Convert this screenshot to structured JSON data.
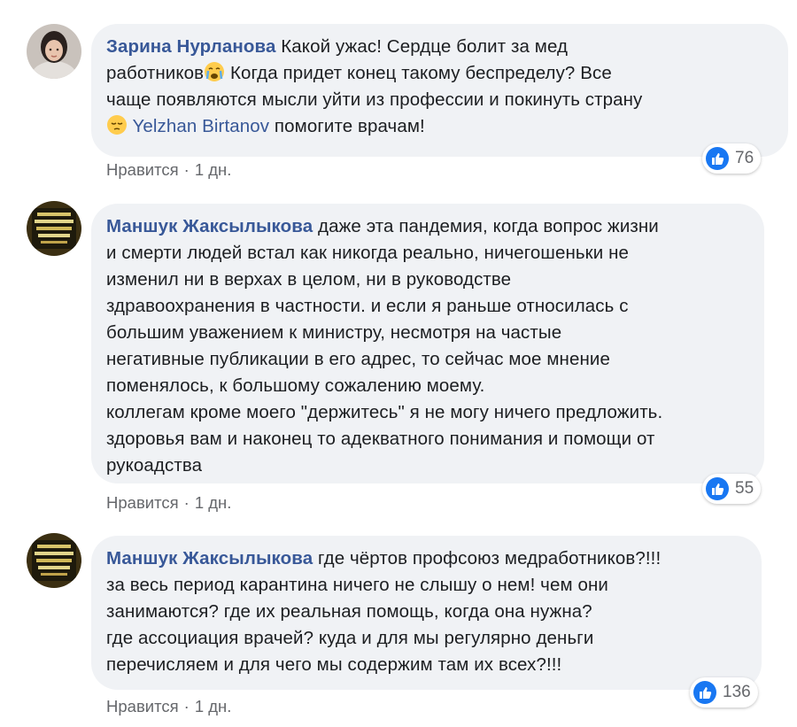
{
  "comments": [
    {
      "author": "Зарина Нурланова",
      "lines": [
        "Какой ужас! Сердце болит за мед",
        "работников",
        " Когда придет конец такому беспределу? Все",
        "чаще появляются мысли уйти из профессии и покинуть страну",
        "Yelzhan Birtanov",
        " помогите врачам!"
      ],
      "emoji_1": "crying-face-emoji",
      "emoji_2": "pensive-face-emoji",
      "reaction_count": "76",
      "like_label": "Нравится",
      "separator": "·",
      "time": "1 дн."
    },
    {
      "author": "Маншук Жаксылыкова",
      "lines": [
        "даже эта пандемия, когда вопрос жизни",
        "и смерти людей встал как никогда реально, ничегошеньки не",
        "изменил ни в верхах в целом, ни в руководстве",
        "здравоохранения в частности. и если я раньше относилась с",
        "большим уважением к министру, несмотря на частые",
        "негативные публикации в его адрес, то сейчас мое мнение",
        "поменялось, к большому сожалению моему.",
        "коллегам кроме моего \"держитесь\" я не могу ничего предложить.",
        "здоровья вам и наконец то адекватного понимания и помощи от",
        "рукоадства"
      ],
      "reaction_count": "55",
      "like_label": "Нравится",
      "separator": "·",
      "time": "1 дн."
    },
    {
      "author": "Маншук Жаксылыкова",
      "lines": [
        "где чёртов профсоюз медработников?!!!",
        "за весь период карантина ничего не слышу о нем! чем они",
        "занимаются? где их реальная помощь, когда она нужна?",
        "где ассоциация врачей? куда и для мы регулярно деньги",
        "перечисляем и для чего мы содержим там их всех?!!!"
      ],
      "reaction_count": "136",
      "like_label": "Нравится",
      "separator": "·",
      "time": "1 дн."
    }
  ],
  "colors": {
    "bubble": "#f0f2f5",
    "author": "#385898",
    "meta": "#65676b",
    "like_blue": "#1877f2"
  }
}
